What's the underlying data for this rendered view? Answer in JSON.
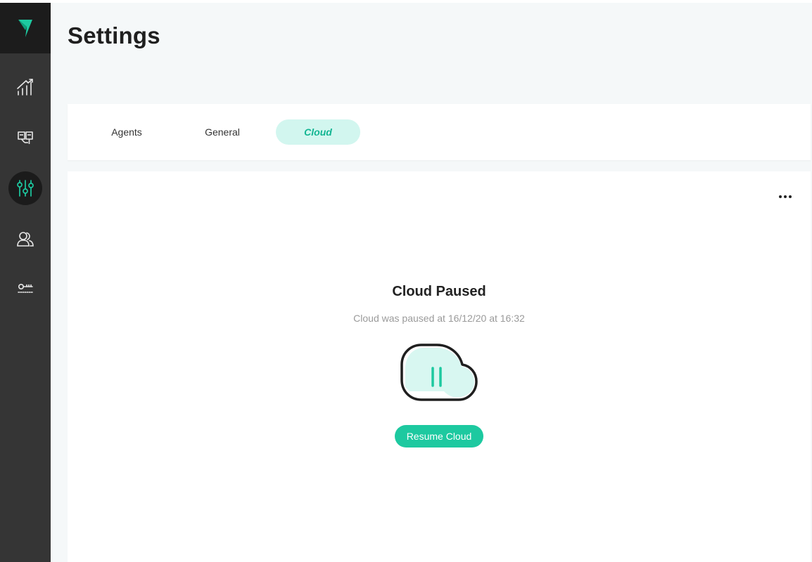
{
  "page": {
    "title": "Settings"
  },
  "sidebar": {
    "items": [
      {
        "name": "analytics",
        "icon": "chart-icon"
      },
      {
        "name": "tasks",
        "icon": "board-icon"
      },
      {
        "name": "settings",
        "icon": "sliders-icon",
        "active": true
      },
      {
        "name": "users",
        "icon": "users-icon"
      },
      {
        "name": "keys",
        "icon": "key-icon"
      }
    ]
  },
  "tabs": [
    {
      "label": "Agents"
    },
    {
      "label": "General"
    },
    {
      "label": "Cloud",
      "active": true
    }
  ],
  "cloud_status": {
    "title": "Cloud Paused",
    "subtitle": "Cloud was paused at 16/12/20 at 16:32",
    "button_label": "Resume Cloud",
    "icon": "cloud-pause-icon"
  },
  "colors": {
    "accent": "#1dc9a0",
    "accent_light": "#d2f6ef",
    "sidebar_bg": "#353535",
    "sidebar_dark": "#1c1c1c",
    "page_bg": "#f5f8f9"
  }
}
